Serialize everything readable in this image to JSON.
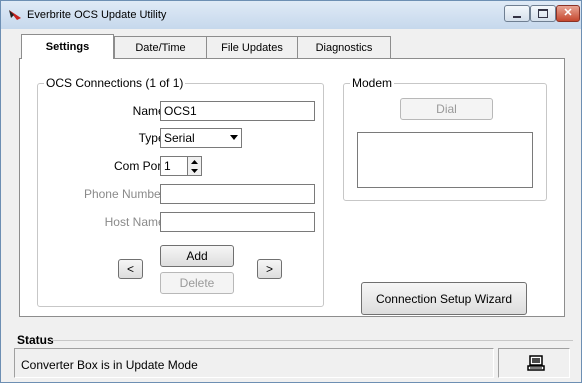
{
  "window": {
    "title": "Everbrite OCS Update Utility"
  },
  "tabs": [
    {
      "label": "Settings",
      "active": true
    },
    {
      "label": "Date/Time",
      "active": false
    },
    {
      "label": "File Updates",
      "active": false
    },
    {
      "label": "Diagnostics",
      "active": false
    }
  ],
  "connections": {
    "legend": "OCS Connections (1 of 1)",
    "name_label": "Name:",
    "name_value": "OCS1",
    "type_label": "Type:",
    "type_value": "Serial",
    "comport_label": "Com Port:",
    "comport_value": "1",
    "phone_label": "Phone Number:",
    "phone_value": "",
    "host_label": "Host Name:",
    "host_value": "",
    "prev_label": "<",
    "next_label": ">",
    "add_label": "Add",
    "delete_label": "Delete"
  },
  "modem": {
    "legend": "Modem",
    "dial_label": "Dial",
    "log_text": ""
  },
  "wizard_label": "Connection Setup Wizard",
  "status": {
    "heading": "Status",
    "message": "Converter Box is in Update Mode",
    "icon": "computer-icon"
  },
  "colors": {
    "title_gradient_top": "#dfeaf6",
    "close_button": "#c5472e",
    "panel_background": "#ffffff",
    "disabled_text": "#8a8a8a"
  }
}
